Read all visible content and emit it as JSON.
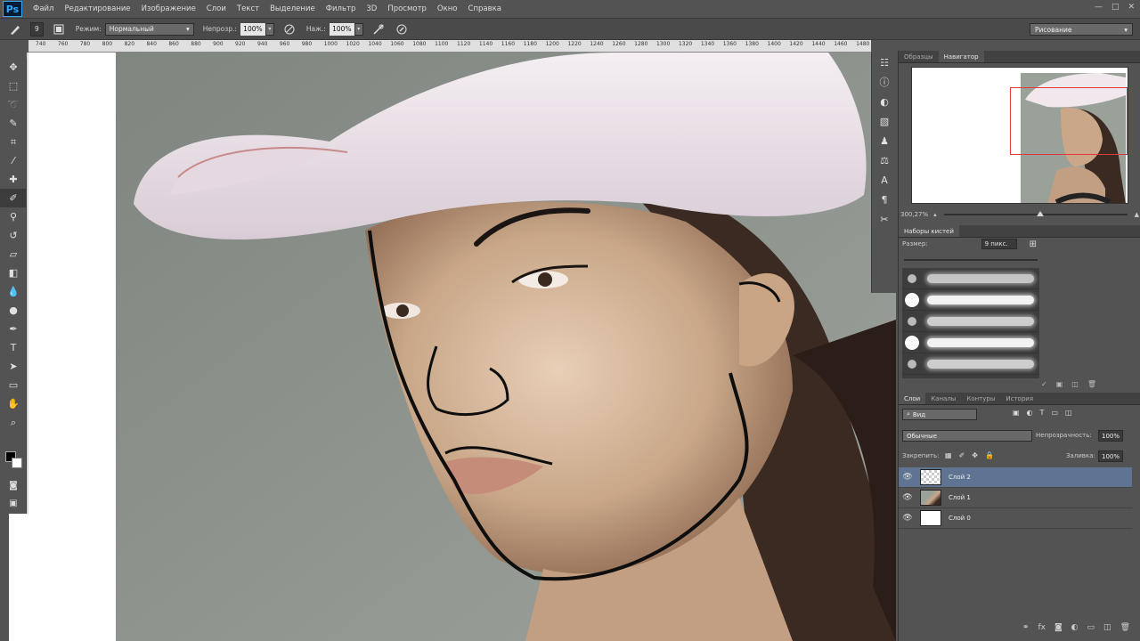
{
  "app": {
    "logo": "Ps"
  },
  "menu": [
    "Файл",
    "Редактирование",
    "Изображение",
    "Слои",
    "Текст",
    "Выделение",
    "Фильтр",
    "3D",
    "Просмотр",
    "Окно",
    "Справка"
  ],
  "window_controls": [
    "—",
    "□",
    "✕"
  ],
  "options": {
    "brush_size": "9",
    "mode_label": "Режим:",
    "mode_value": "Нормальный",
    "opacity_label": "Непрозр.:",
    "opacity_value": "100%",
    "flow_label": "Наж.:",
    "flow_value": "100%",
    "workspace": "Рисование"
  },
  "ruler": [
    "740",
    "760",
    "780",
    "800",
    "820",
    "840",
    "860",
    "880",
    "900",
    "920",
    "940",
    "960",
    "980",
    "1000",
    "1020",
    "1040",
    "1060",
    "1080",
    "1100",
    "1120",
    "1140",
    "1160",
    "1180",
    "1200",
    "1220",
    "1240",
    "1260",
    "1280",
    "1300",
    "1320",
    "1340",
    "1360",
    "1380",
    "1400",
    "1420",
    "1440",
    "1460",
    "1480"
  ],
  "tools": [
    "move-icon",
    "marquee-icon",
    "lasso-icon",
    "quick-select-icon",
    "crop-icon",
    "eyedropper-icon",
    "healing-icon",
    "brush-icon",
    "stamp-icon",
    "history-brush-icon",
    "eraser-icon",
    "gradient-icon",
    "blur-icon",
    "dodge-icon",
    "pen-icon",
    "type-icon",
    "path-select-icon",
    "shape-icon",
    "hand-icon",
    "zoom-icon"
  ],
  "navigator": {
    "tabs": [
      "Образцы",
      "Навигатор"
    ],
    "zoom": "300,27%"
  },
  "brush_presets": {
    "tab": "Наборы кистей",
    "size_label": "Размер:",
    "size_value": "9 пикс."
  },
  "layers": {
    "tabs": [
      "Слои",
      "Каналы",
      "Контуры",
      "История"
    ],
    "filter": "Вид",
    "blend_mode": "Обычные",
    "opacity_label": "Непрозрачность:",
    "opacity_value": "100%",
    "lock_label": "Закрепить:",
    "fill_label": "Заливка:",
    "fill_value": "100%",
    "items": [
      {
        "name": "Слой 2",
        "selected": true
      },
      {
        "name": "Слой 1",
        "selected": false
      },
      {
        "name": "Слой 0",
        "selected": false
      }
    ]
  }
}
